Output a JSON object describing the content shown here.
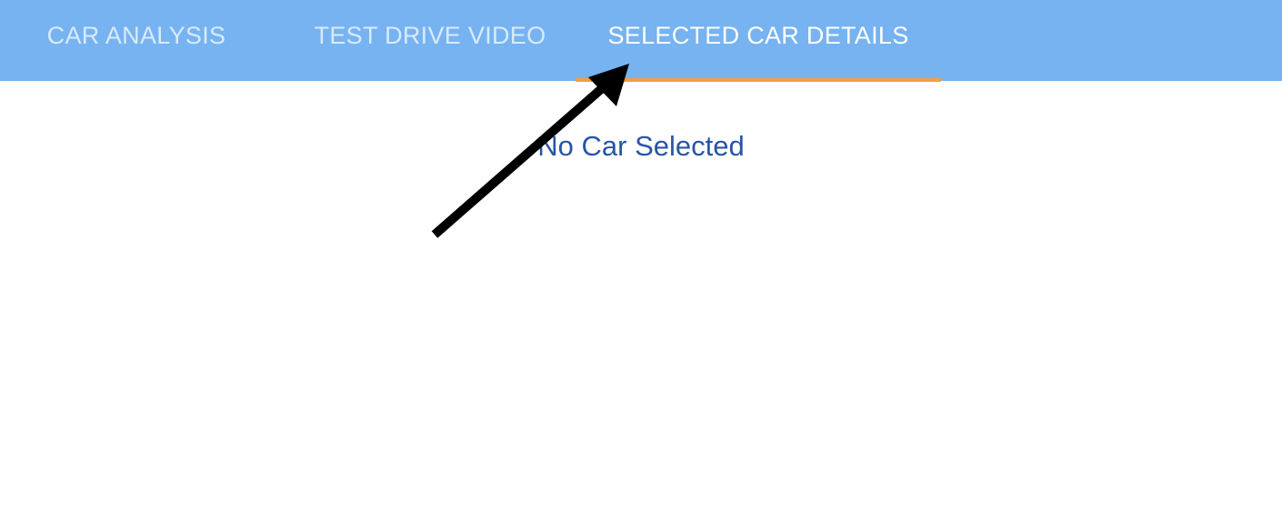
{
  "tabs": [
    {
      "label": "CAR ANALYSIS",
      "active": false
    },
    {
      "label": "TEST DRIVE VIDEO",
      "active": false
    },
    {
      "label": "SELECTED CAR DETAILS",
      "active": true
    }
  ],
  "content": {
    "empty_message": "No Car Selected"
  },
  "colors": {
    "tabbar_background": "#76b3f0",
    "active_indicator": "#f0a040",
    "message_text": "#2855a5",
    "arrow": "#000000"
  },
  "annotation": {
    "icon": "arrow-annotation-icon"
  }
}
